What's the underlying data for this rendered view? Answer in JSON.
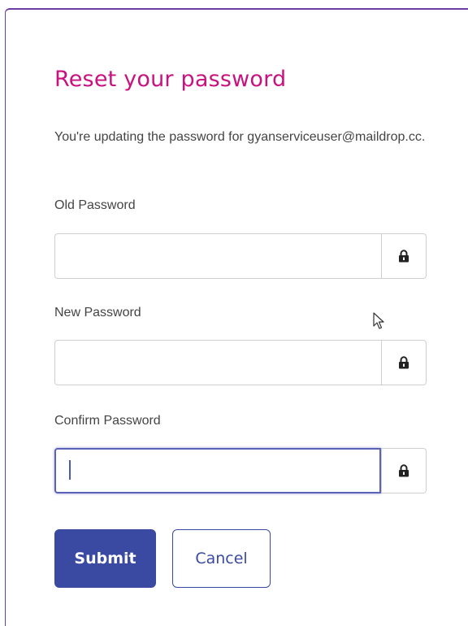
{
  "dialog": {
    "title": "Reset your password",
    "description": "You're updating the password for gyanserviceuser@maildrop.cc."
  },
  "fields": {
    "old_password": {
      "label": "Old Password",
      "value": "",
      "placeholder": "",
      "addon_icon": "lock-icon"
    },
    "new_password": {
      "label": "New Password",
      "value": "",
      "placeholder": "",
      "addon_icon": "lock-icon"
    },
    "confirm_password": {
      "label": "Confirm Password",
      "value": "",
      "placeholder": "",
      "addon_icon": "lock-icon",
      "focused": true
    }
  },
  "buttons": {
    "submit_label": "Submit",
    "cancel_label": "Cancel"
  },
  "colors": {
    "title": "#c8127f",
    "primary": "#3a4aa3",
    "focus_border": "#5b63b8",
    "card_border": "#6b3fa0"
  }
}
